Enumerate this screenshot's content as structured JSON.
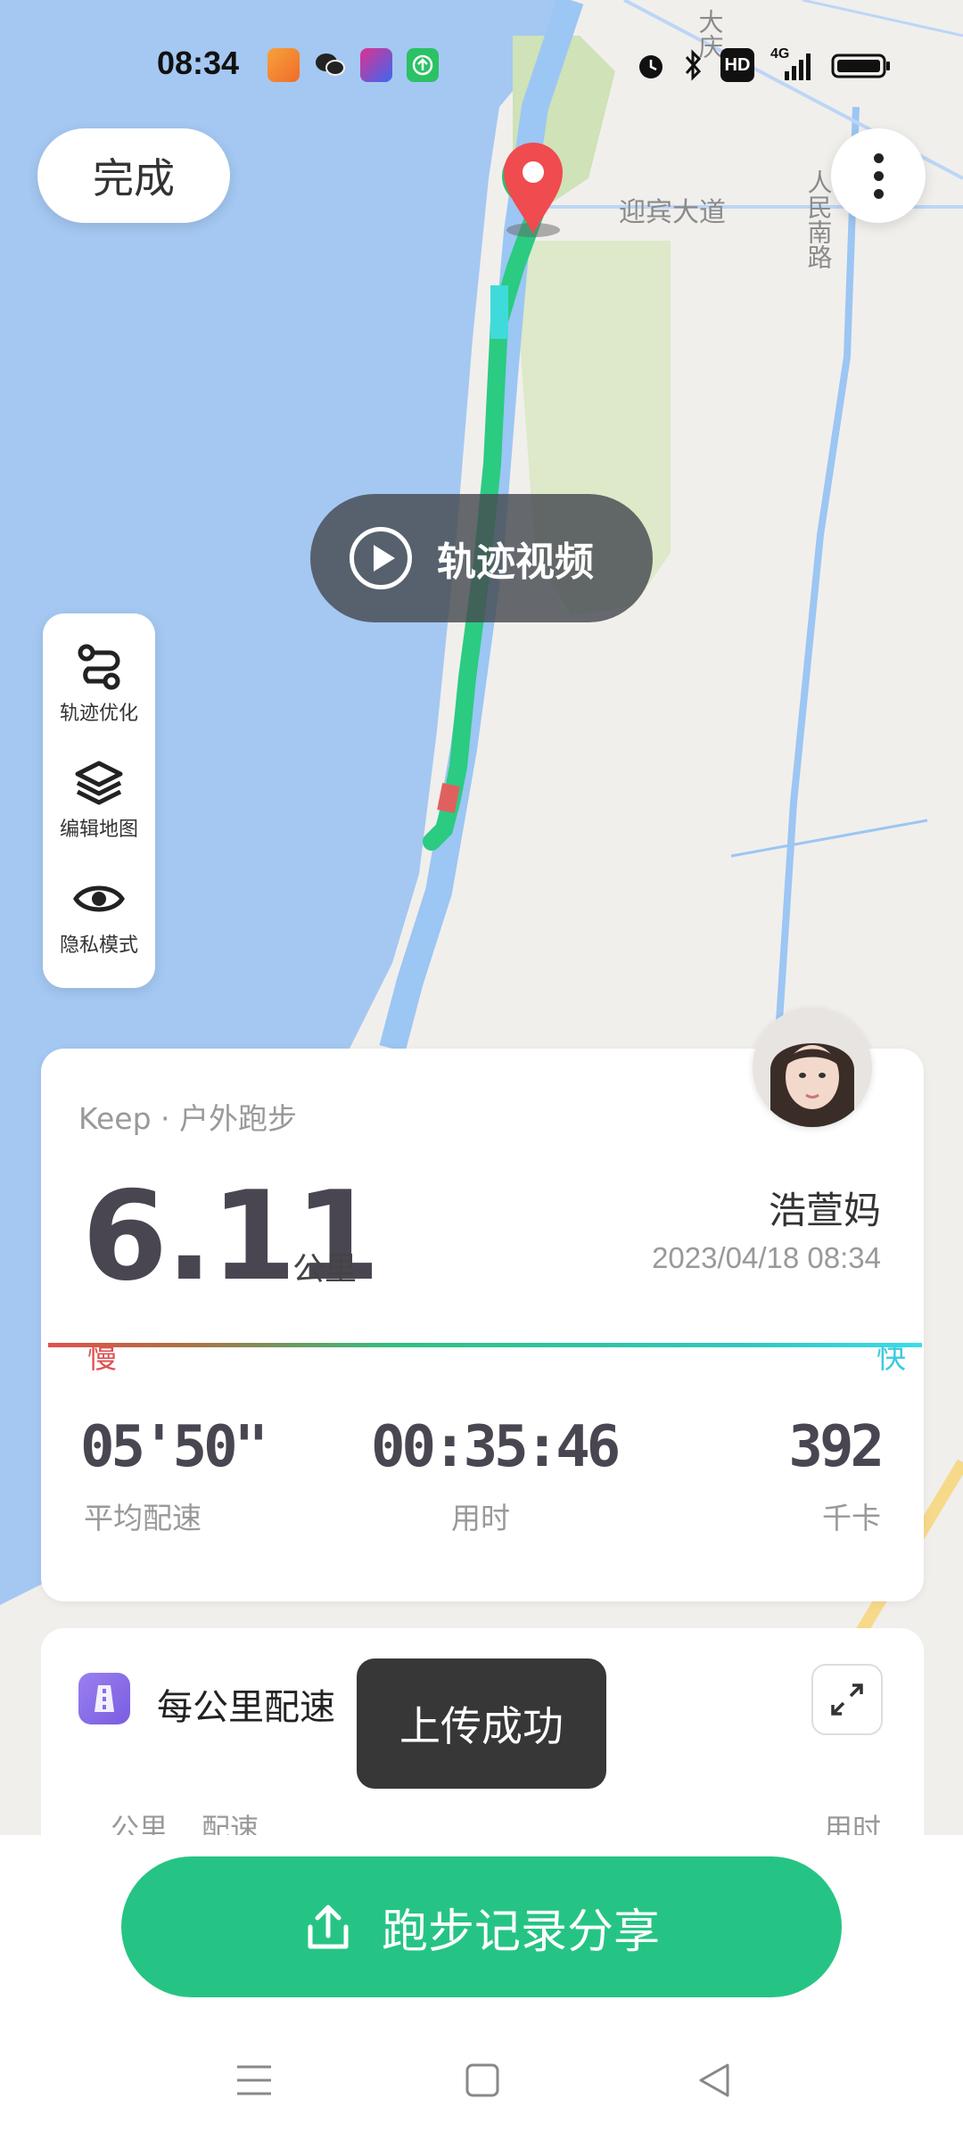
{
  "status_bar": {
    "time": "08:34",
    "icons": [
      "brand-heart-icon",
      "wechat-icon",
      "video-app-icon",
      "upload-app-icon",
      "alarm-icon",
      "bluetooth-icon",
      "hd-icon",
      "4g-signal-icon",
      "battery-icon"
    ],
    "hd_label": "HD",
    "net_label": "4G"
  },
  "map": {
    "road_label_1": "迎宾大道",
    "road_label_2": "人民南路",
    "road_label_3": "大庆",
    "colors": {
      "water": "#a4c8f2",
      "land": "#f1efec",
      "park": "#dde9c8",
      "river": "#9cc6f3",
      "track": "#2bcb82",
      "marker": "#f04b4f",
      "start_marker": "#2bbf72"
    }
  },
  "top": {
    "done_label": "完成"
  },
  "track_video": {
    "label": "轨迹视频"
  },
  "tools": [
    {
      "label": "轨迹优化",
      "icon": "route-optimize-icon"
    },
    {
      "label": "编辑地图",
      "icon": "layers-icon"
    },
    {
      "label": "隐私模式",
      "icon": "eye-icon"
    }
  ],
  "summary": {
    "subtitle": "Keep · 户外跑步",
    "distance": "6.11",
    "distance_unit": "公里",
    "user_name": "浩萱妈",
    "datetime": "2023/04/18 08:34",
    "slow_label": "慢",
    "fast_label": "快",
    "pace_value": "05'50\"",
    "pace_label": "平均配速",
    "time_value": "00:35:46",
    "time_label": "用时",
    "kcal_value": "392",
    "kcal_label": "千卡"
  },
  "km_pace": {
    "title": "每公里配速",
    "col_km": "公里",
    "col_pace": "配速",
    "col_time": "用时"
  },
  "toast": {
    "message": "上传成功"
  },
  "share": {
    "label": "跑步记录分享"
  }
}
